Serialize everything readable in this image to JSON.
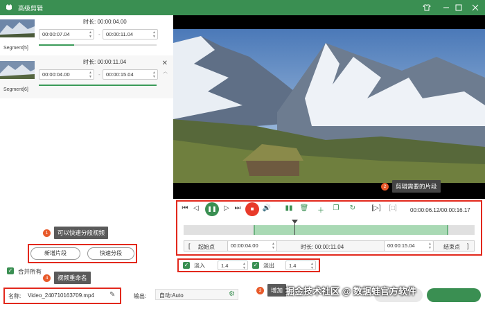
{
  "window": {
    "title": "高级剪辑",
    "controls": [
      "shirt-icon",
      "minimize-icon",
      "maximize-icon",
      "close-icon"
    ]
  },
  "segments": [
    {
      "name": "Segment[5]",
      "duration_label": "时长:",
      "duration": "00:00:04.00",
      "start": "00:00:07.04",
      "end": "00:00:11.04",
      "progress": 0.3
    },
    {
      "name": "Segment[6]",
      "duration_label": "时长:",
      "duration": "00:00:11.04",
      "start": "00:00:04.00",
      "end": "00:00:15.04",
      "progress": 1.0
    }
  ],
  "callouts": {
    "c1": {
      "num": "1",
      "text": "可以快速分段视频"
    },
    "c2": {
      "num": "2",
      "text": "剪辑需要的片段"
    },
    "c3": {
      "num": "3",
      "text": "增加"
    },
    "c4": {
      "num": "4",
      "text": "视频重命名"
    }
  },
  "buttons": {
    "add_segment": "新增片段",
    "quick_split": "快速分段"
  },
  "merge_all": "合并所有",
  "name_label": "名称:",
  "file_name": "Video_240710163709.mp4",
  "output_label": "输出:",
  "output_value": "自动:Auto",
  "player": {
    "time": "00:00:06.12/00:00:16.17",
    "playhead": 0.38
  },
  "trim": {
    "start_label": "起始点",
    "start": "00:00:04.00",
    "duration_label": "时长:",
    "duration": "00:00:11.04",
    "end": "00:00:15.04",
    "end_label": "结束点",
    "range": [
      0.24,
      0.91
    ]
  },
  "fade": {
    "in_label": "淡入",
    "in_value": "1.4",
    "out_label": "淡出",
    "out_value": "1.4"
  },
  "watermark": "掘金技术社区 @ 数据蛙官方软件"
}
